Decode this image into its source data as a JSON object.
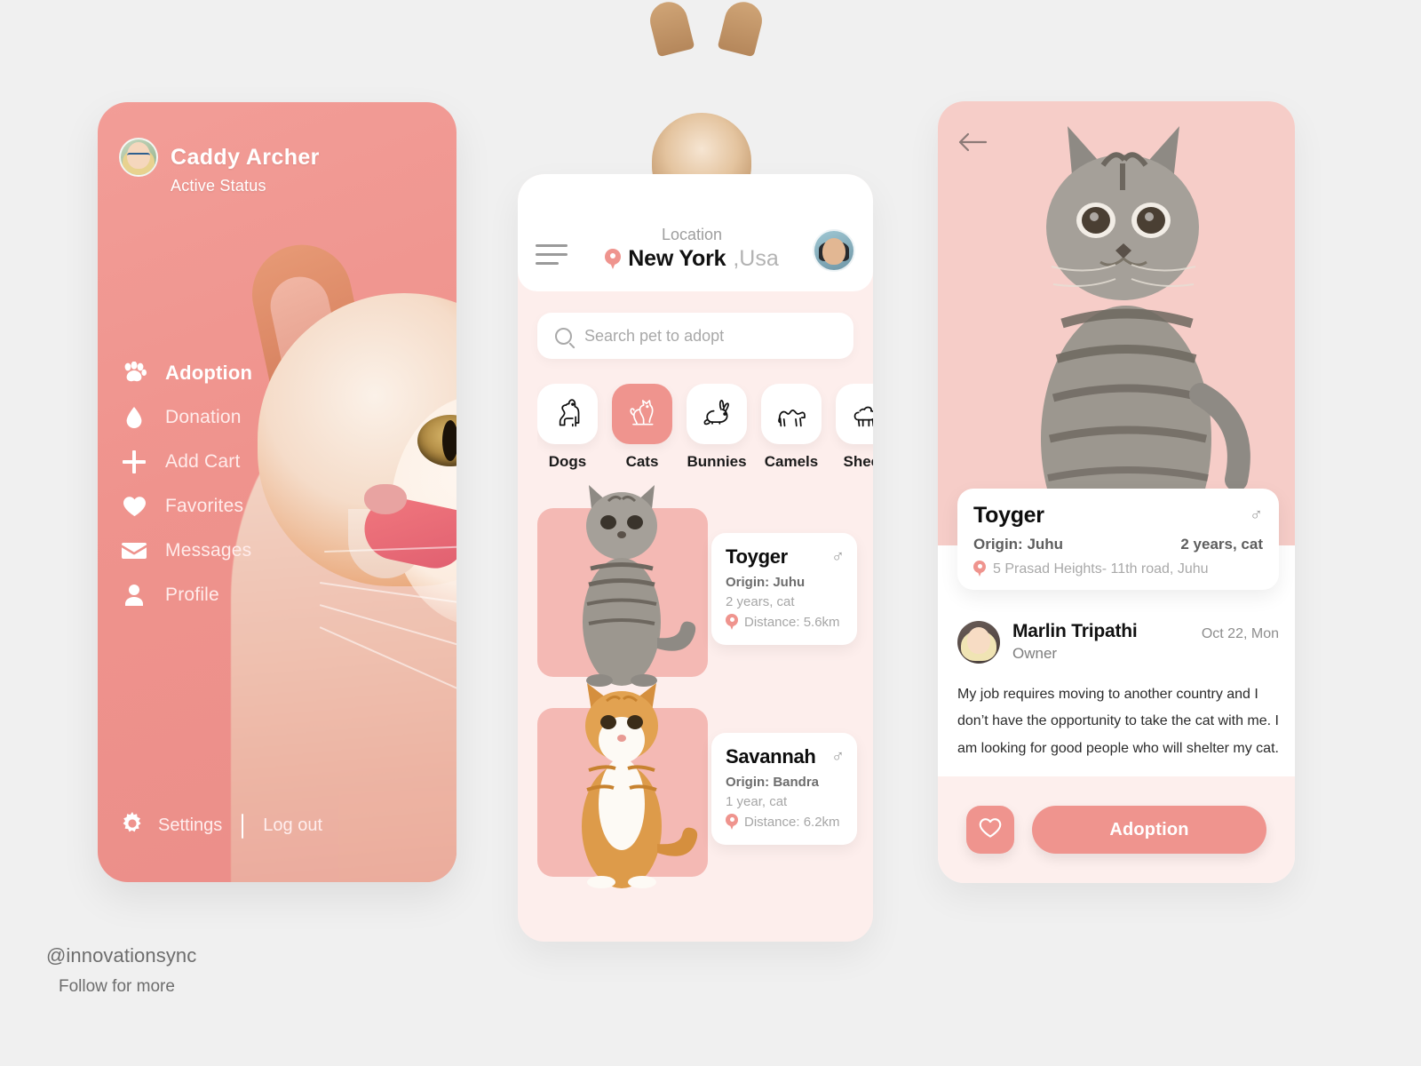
{
  "drawer": {
    "user": {
      "name": "Caddy Archer",
      "status": "Active Status",
      "avatar_icon": "user-avatar-female"
    },
    "nav": [
      {
        "label": "Adoption",
        "icon": "paw-icon",
        "active": true
      },
      {
        "label": "Donation",
        "icon": "droplet-icon",
        "active": false
      },
      {
        "label": "Add Cart",
        "icon": "plus-icon",
        "active": false
      },
      {
        "label": "Favorites",
        "icon": "heart-icon",
        "active": false
      },
      {
        "label": "Messages",
        "icon": "envelope-icon",
        "active": false
      },
      {
        "label": "Profile",
        "icon": "person-icon",
        "active": false
      }
    ],
    "footer": {
      "settings": "Settings",
      "logout": "Log out",
      "settings_icon": "gear-icon"
    }
  },
  "home": {
    "menu_icon": "hamburger-icon",
    "location_label": "Location",
    "location_city": "New York",
    "location_country": ",Usa",
    "location_pin_icon": "map-pin-icon",
    "header_avatar_icon": "user-avatar-male",
    "search": {
      "placeholder": "Search pet to adopt",
      "value": "",
      "icon": "search-icon"
    },
    "categories": [
      {
        "label": "Dogs",
        "icon": "dog-icon",
        "active": false
      },
      {
        "label": "Cats",
        "icon": "cat-icon",
        "active": true
      },
      {
        "label": "Bunnies",
        "icon": "rabbit-icon",
        "active": false
      },
      {
        "label": "Camels",
        "icon": "camel-icon",
        "active": false
      },
      {
        "label": "Sheep",
        "icon": "sheep-icon",
        "active": false
      }
    ],
    "pets": [
      {
        "name": "Toyger",
        "gender": "♂",
        "origin": "Origin: Juhu",
        "age": "2 years, cat",
        "distance": "Distance: 5.6km",
        "photo": "tabby-cat-photo"
      },
      {
        "name": "Savannah",
        "gender": "♂",
        "origin": "Origin: Bandra",
        "age": "1 year, cat",
        "distance": "Distance: 6.2km",
        "photo": "ginger-cat-photo"
      }
    ]
  },
  "detail": {
    "back_icon": "back-arrow-icon",
    "hero_photo": "tabby-cat-hero-photo",
    "pet": {
      "name": "Toyger",
      "gender": "♂",
      "origin": "Origin: Juhu",
      "age": "2 years, cat",
      "address": "5 Prasad Heights- 11th road, Juhu",
      "address_pin_icon": "map-pin-icon"
    },
    "owner": {
      "name": "Marlin Tripathi",
      "role": "Owner",
      "date": "Oct 22, Mon",
      "avatar_icon": "user-avatar-owner",
      "description": "My job requires moving to another country and I don’t have the opportunity to take the cat with me. I am looking for good people who will shelter my cat."
    },
    "actions": {
      "favorite_label": "",
      "favorite_icon": "heart-outline-icon",
      "adopt_label": "Adoption"
    }
  },
  "watermark": {
    "handle": "@innovationsync",
    "tagline": "Follow for more"
  },
  "colors": {
    "accent_pink": "#EF948E",
    "soft_pink_bg": "#FDEEEC",
    "hero_pink": "#F6CDC8",
    "photo_tile_pink": "#F4B9B4",
    "page_bg": "#F0F0F0",
    "drawer_gradient_from": "#F29D97",
    "drawer_gradient_to": "#EB8E89"
  }
}
